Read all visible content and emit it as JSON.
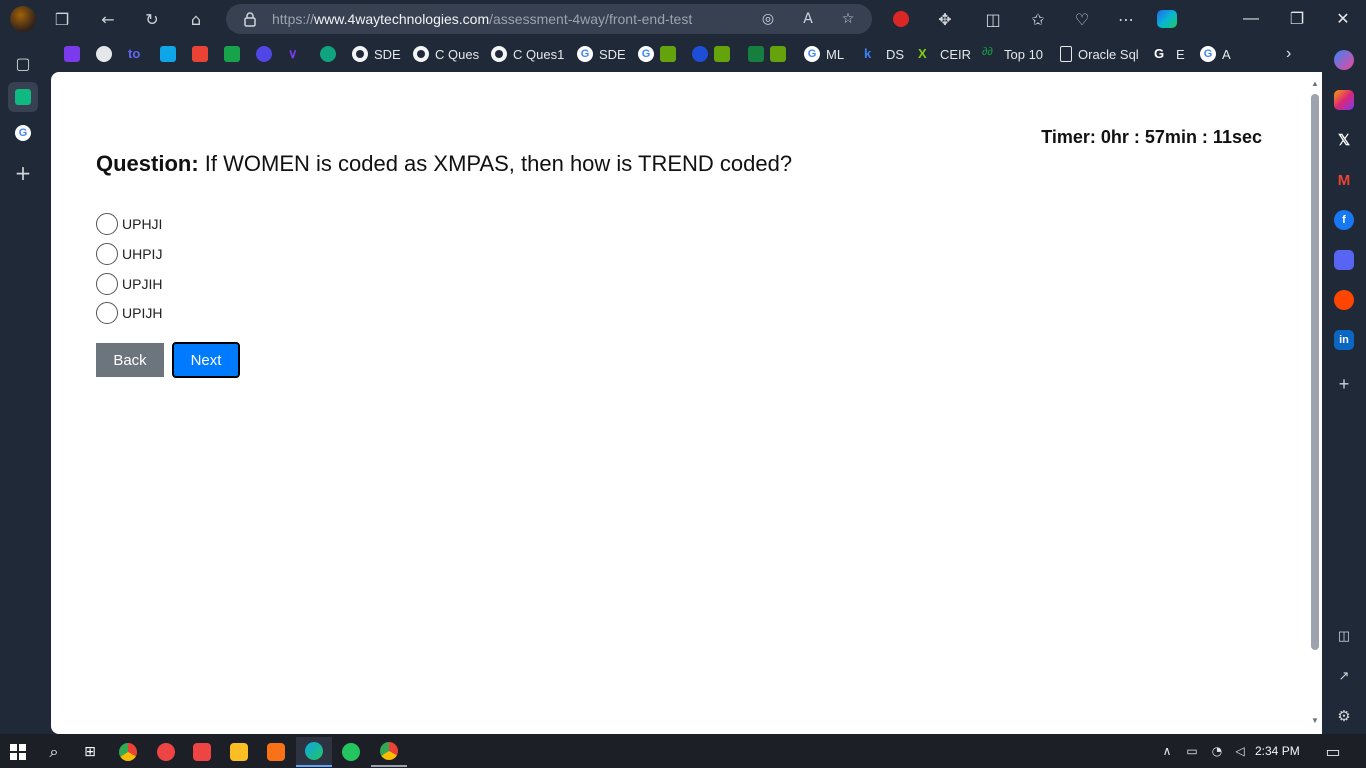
{
  "browser": {
    "url_prefix": "https://",
    "url_domain": "www.4waytechnologies.com",
    "url_path": "/assessment-4way/front-end-test",
    "window_controls": {
      "minimize": "—",
      "restore": "❐",
      "close": "✕"
    }
  },
  "bookmarks": [
    {
      "label": "SDE",
      "icon": "github-icon"
    },
    {
      "label": "C Ques",
      "icon": "github-icon"
    },
    {
      "label": "C Ques1",
      "icon": "github-icon"
    },
    {
      "label": "SDE",
      "icon": "google-icon"
    },
    {
      "label": "ML",
      "icon": "google-icon"
    },
    {
      "label": "DS",
      "icon": "k-icon"
    },
    {
      "label": "CEIR",
      "icon": "ceir-icon"
    },
    {
      "label": "Top 10",
      "icon": "gfg-icon"
    },
    {
      "label": "Oracle Sql",
      "icon": "page-icon"
    },
    {
      "label": "E",
      "icon": "google-icon"
    },
    {
      "label": "A",
      "icon": "google-icon"
    }
  ],
  "page": {
    "timer": "Timer: 0hr : 57min : 11sec",
    "question_label": "Question:",
    "question_text": " If WOMEN is coded as XMPAS, then how is TREND coded?",
    "options": [
      "UPHJI",
      "UHPIJ",
      "UPJIH",
      "UPIJH"
    ],
    "back_label": "Back",
    "next_label": "Next"
  },
  "taskbar": {
    "clock": "2:34 PM"
  },
  "colors": {
    "next_button": "#007bff",
    "back_button": "#6c757d",
    "chrome_bg": "#1f2937"
  }
}
